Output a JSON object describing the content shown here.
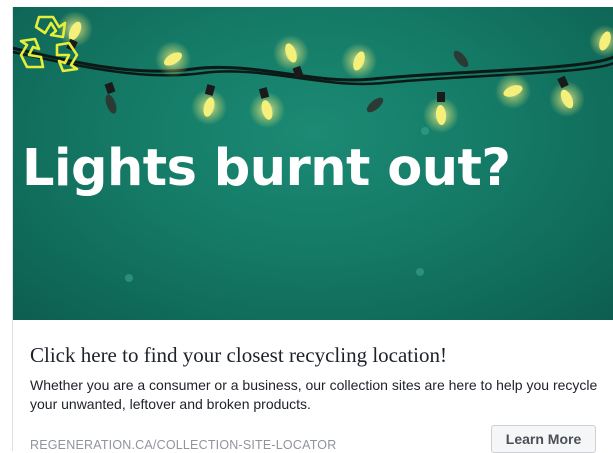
{
  "banner": {
    "headline": "Lights burnt out?",
    "recycle_icon": "recycle-icon",
    "colors": {
      "background": "#147a66",
      "bulb": "#f4f07a",
      "icon": "#e6ee3a"
    }
  },
  "ad": {
    "title": "Click here to find your closest recycling location!",
    "description": "Whether you are a consumer or a business, our collection sites are here to help you recycle your unwanted, leftover and broken products.",
    "url": "REGENERATION.CA/COLLECTION-SITE-LOCATOR",
    "cta_label": "Learn More"
  }
}
